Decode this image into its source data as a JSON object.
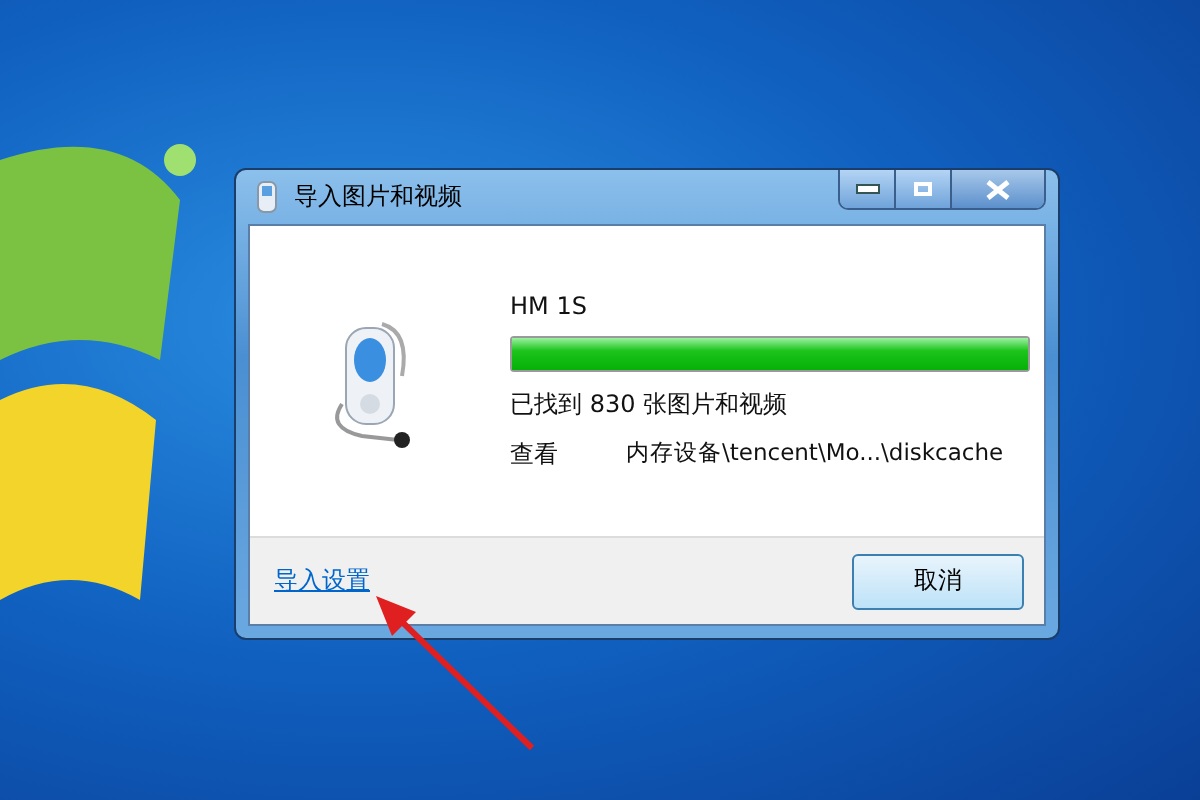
{
  "window": {
    "title": "导入图片和视频"
  },
  "device": {
    "name": "HM 1S",
    "level": 1,
    "found": "已找到 830 张图片和视频",
    "view_label": "查看",
    "path": "内存设备\\tencent\\Mo...\\diskcache"
  },
  "footer": {
    "link": "导入设置",
    "buttons": [
      "取消"
    ]
  }
}
